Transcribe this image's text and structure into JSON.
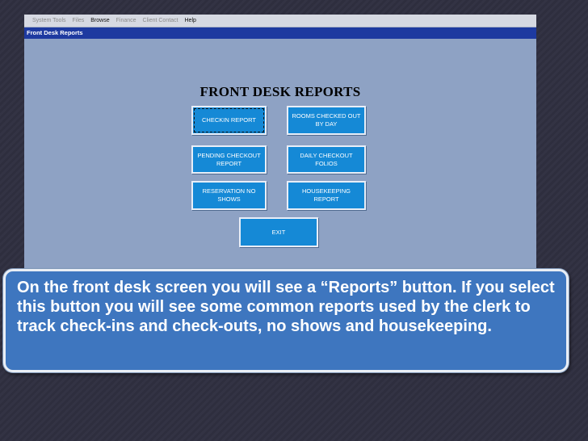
{
  "menu": {
    "items": [
      {
        "label": "System Tools",
        "enabled": false
      },
      {
        "label": "Files",
        "enabled": false
      },
      {
        "label": "Browse",
        "enabled": true
      },
      {
        "label": "Finance",
        "enabled": false
      },
      {
        "label": "Client Contact",
        "enabled": false
      },
      {
        "label": "Help",
        "enabled": true
      }
    ]
  },
  "window": {
    "title": "Front Desk Reports"
  },
  "form": {
    "heading": "FRONT DESK REPORTS",
    "buttons": {
      "checkin_report": "CHECKIN REPORT",
      "rooms_checked_out_by_day": "ROOMS CHECKED OUT BY DAY",
      "pending_checkout_report": "PENDING CHECKOUT REPORT",
      "daily_checkout_folios": "DAILY CHECKOUT FOLIOS",
      "reservation_no_shows": "RESERVATION NO SHOWS",
      "housekeeping_report": "HOUSEKEEPING REPORT",
      "exit": "EXIT"
    }
  },
  "callout": {
    "text": "On the front desk screen you will see a “Reports” button. If you select this button you will see some common reports used by the clerk to track check-ins and check-outs, no shows and housekeeping."
  }
}
